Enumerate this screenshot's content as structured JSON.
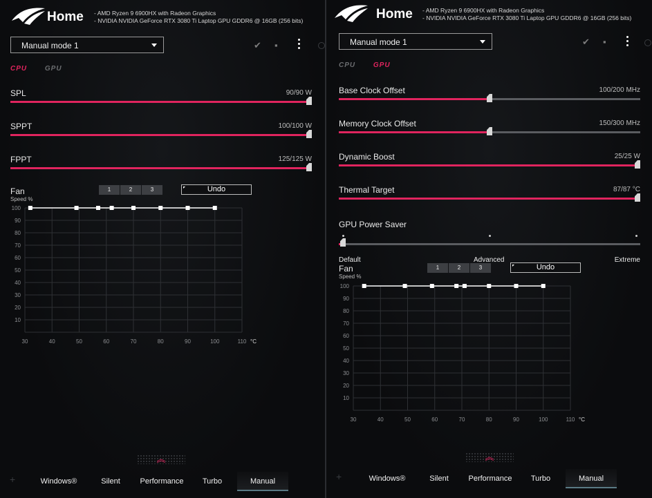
{
  "left": {
    "title": "Home",
    "hw": [
      "AMD Ryzen 9 6900HX with Radeon Graphics",
      "NVIDIA NVIDIA GeForce RTX 3080 Ti Laptop GPU GDDR6 @ 16GB (256 bits)"
    ],
    "mode": "Manual mode 1",
    "tabs": {
      "cpu": "CPU",
      "gpu": "GPU",
      "active": "cpu"
    },
    "sliders": [
      {
        "label": "SPL",
        "value": "90/90 W",
        "fraction": 1.0
      },
      {
        "label": "SPPT",
        "value": "100/100 W",
        "fraction": 1.0
      },
      {
        "label": "FPPT",
        "value": "125/125 W",
        "fraction": 1.0
      }
    ],
    "fan": {
      "label": "Fan",
      "sub": "Speed %",
      "segments": [
        "1",
        "2",
        "3"
      ],
      "undo": "Undo"
    }
  },
  "right": {
    "title": "Home",
    "hw": [
      "AMD Ryzen 9 6900HX with Radeon Graphics",
      "NVIDIA NVIDIA GeForce RTX 3080 Ti Laptop GPU GDDR6 @ 16GB (256 bits)"
    ],
    "mode": "Manual mode 1",
    "tabs": {
      "cpu": "CPU",
      "gpu": "GPU",
      "active": "gpu"
    },
    "sliders": [
      {
        "label": "Base Clock Offset",
        "value": "100/200 MHz",
        "fraction": 0.5
      },
      {
        "label": "Memory Clock Offset",
        "value": "150/300 MHz",
        "fraction": 0.5
      },
      {
        "label": "Dynamic Boost",
        "value": "25/25 W",
        "fraction": 1.0
      },
      {
        "label": "Thermal Target",
        "value": "87/87 °C",
        "fraction": 1.0
      }
    ],
    "power_saver": {
      "label": "GPU Power Saver",
      "options": [
        "Default",
        "Advanced",
        "Extreme"
      ],
      "selected": "Default"
    },
    "fan": {
      "label": "Fan",
      "sub": "Speed %",
      "segments": [
        "1",
        "2",
        "3"
      ],
      "undo": "Undo"
    }
  },
  "nav": {
    "items": [
      "Windows®",
      "Silent",
      "Performance",
      "Turbo",
      "Manual"
    ],
    "active": "Manual"
  },
  "chart_data": [
    {
      "type": "line",
      "name": "",
      "x_ticks": [
        "30",
        "40",
        "50",
        "60",
        "70",
        "80",
        "90",
        "100",
        "110"
      ],
      "x_unit": "°C",
      "y_ticks": [
        "10",
        "20",
        "30",
        "40",
        "50",
        "60",
        "70",
        "80",
        "90",
        "100"
      ],
      "xlim": [
        30,
        110
      ],
      "ylim": [
        0,
        100
      ],
      "x": [
        32,
        49,
        57,
        62,
        70,
        80,
        90,
        100
      ],
      "y": [
        100,
        100,
        100,
        100,
        100,
        100,
        100,
        100
      ]
    },
    {
      "type": "line",
      "name": "",
      "x_ticks": [
        "30",
        "40",
        "50",
        "60",
        "70",
        "80",
        "90",
        "100",
        "110"
      ],
      "x_unit": "°C",
      "y_ticks": [
        "10",
        "20",
        "30",
        "40",
        "50",
        "60",
        "70",
        "80",
        "90",
        "100"
      ],
      "xlim": [
        30,
        110
      ],
      "ylim": [
        0,
        100
      ],
      "x": [
        34,
        49,
        59,
        68,
        71,
        80,
        90,
        100
      ],
      "y": [
        100,
        100,
        100,
        100,
        100,
        100,
        100,
        100
      ]
    }
  ],
  "colors": {
    "accent": "#e0245e",
    "track": "#5a5c60",
    "bg": "#0c0d0f"
  }
}
